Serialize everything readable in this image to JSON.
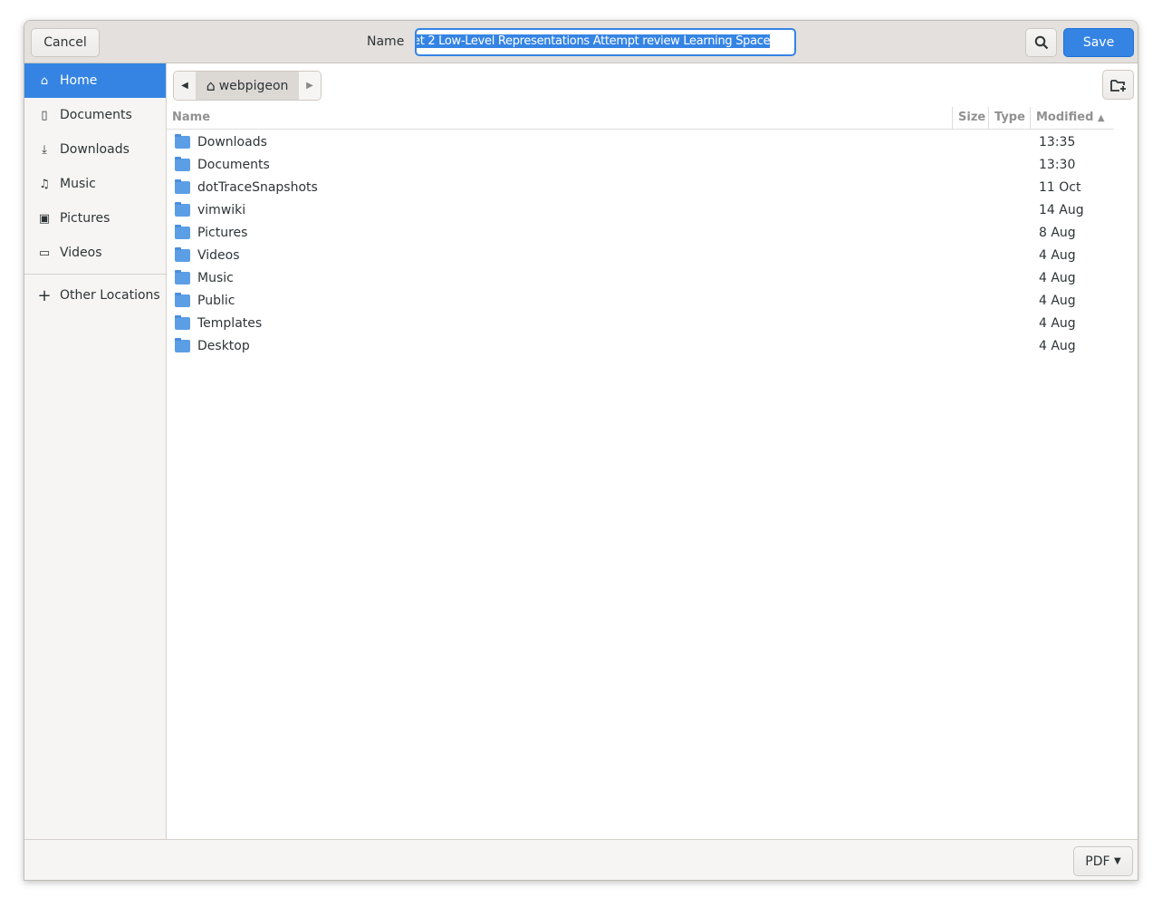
{
  "header": {
    "cancel": "Cancel",
    "name_label": "Name",
    "name_value": "et 2 Low-Level Representations Attempt review Learning Space",
    "save": "Save",
    "search_icon": "search-icon"
  },
  "sidebar": {
    "items": [
      {
        "label": "Home",
        "icon": "home-icon",
        "active": true
      },
      {
        "label": "Documents",
        "icon": "document-icon"
      },
      {
        "label": "Downloads",
        "icon": "download-icon"
      },
      {
        "label": "Music",
        "icon": "music-icon"
      },
      {
        "label": "Pictures",
        "icon": "picture-icon"
      },
      {
        "label": "Videos",
        "icon": "video-icon"
      }
    ],
    "other": "Other Locations"
  },
  "path": {
    "current": "webpigeon"
  },
  "columns": {
    "name": "Name",
    "size": "Size",
    "type": "Type",
    "modified": "Modified"
  },
  "files": [
    {
      "name": "Downloads",
      "modified": "13:35"
    },
    {
      "name": "Documents",
      "modified": "13:30"
    },
    {
      "name": "dotTraceSnapshots",
      "modified": "11 Oct"
    },
    {
      "name": "vimwiki",
      "modified": "14 Aug"
    },
    {
      "name": "Pictures",
      "modified": "8 Aug"
    },
    {
      "name": "Videos",
      "modified": "4 Aug"
    },
    {
      "name": "Music",
      "modified": "4 Aug"
    },
    {
      "name": "Public",
      "modified": "4 Aug"
    },
    {
      "name": "Templates",
      "modified": "4 Aug"
    },
    {
      "name": "Desktop",
      "modified": "4 Aug"
    }
  ],
  "filter": {
    "selected": "PDF"
  },
  "colors": {
    "accent": "#3584e4"
  }
}
